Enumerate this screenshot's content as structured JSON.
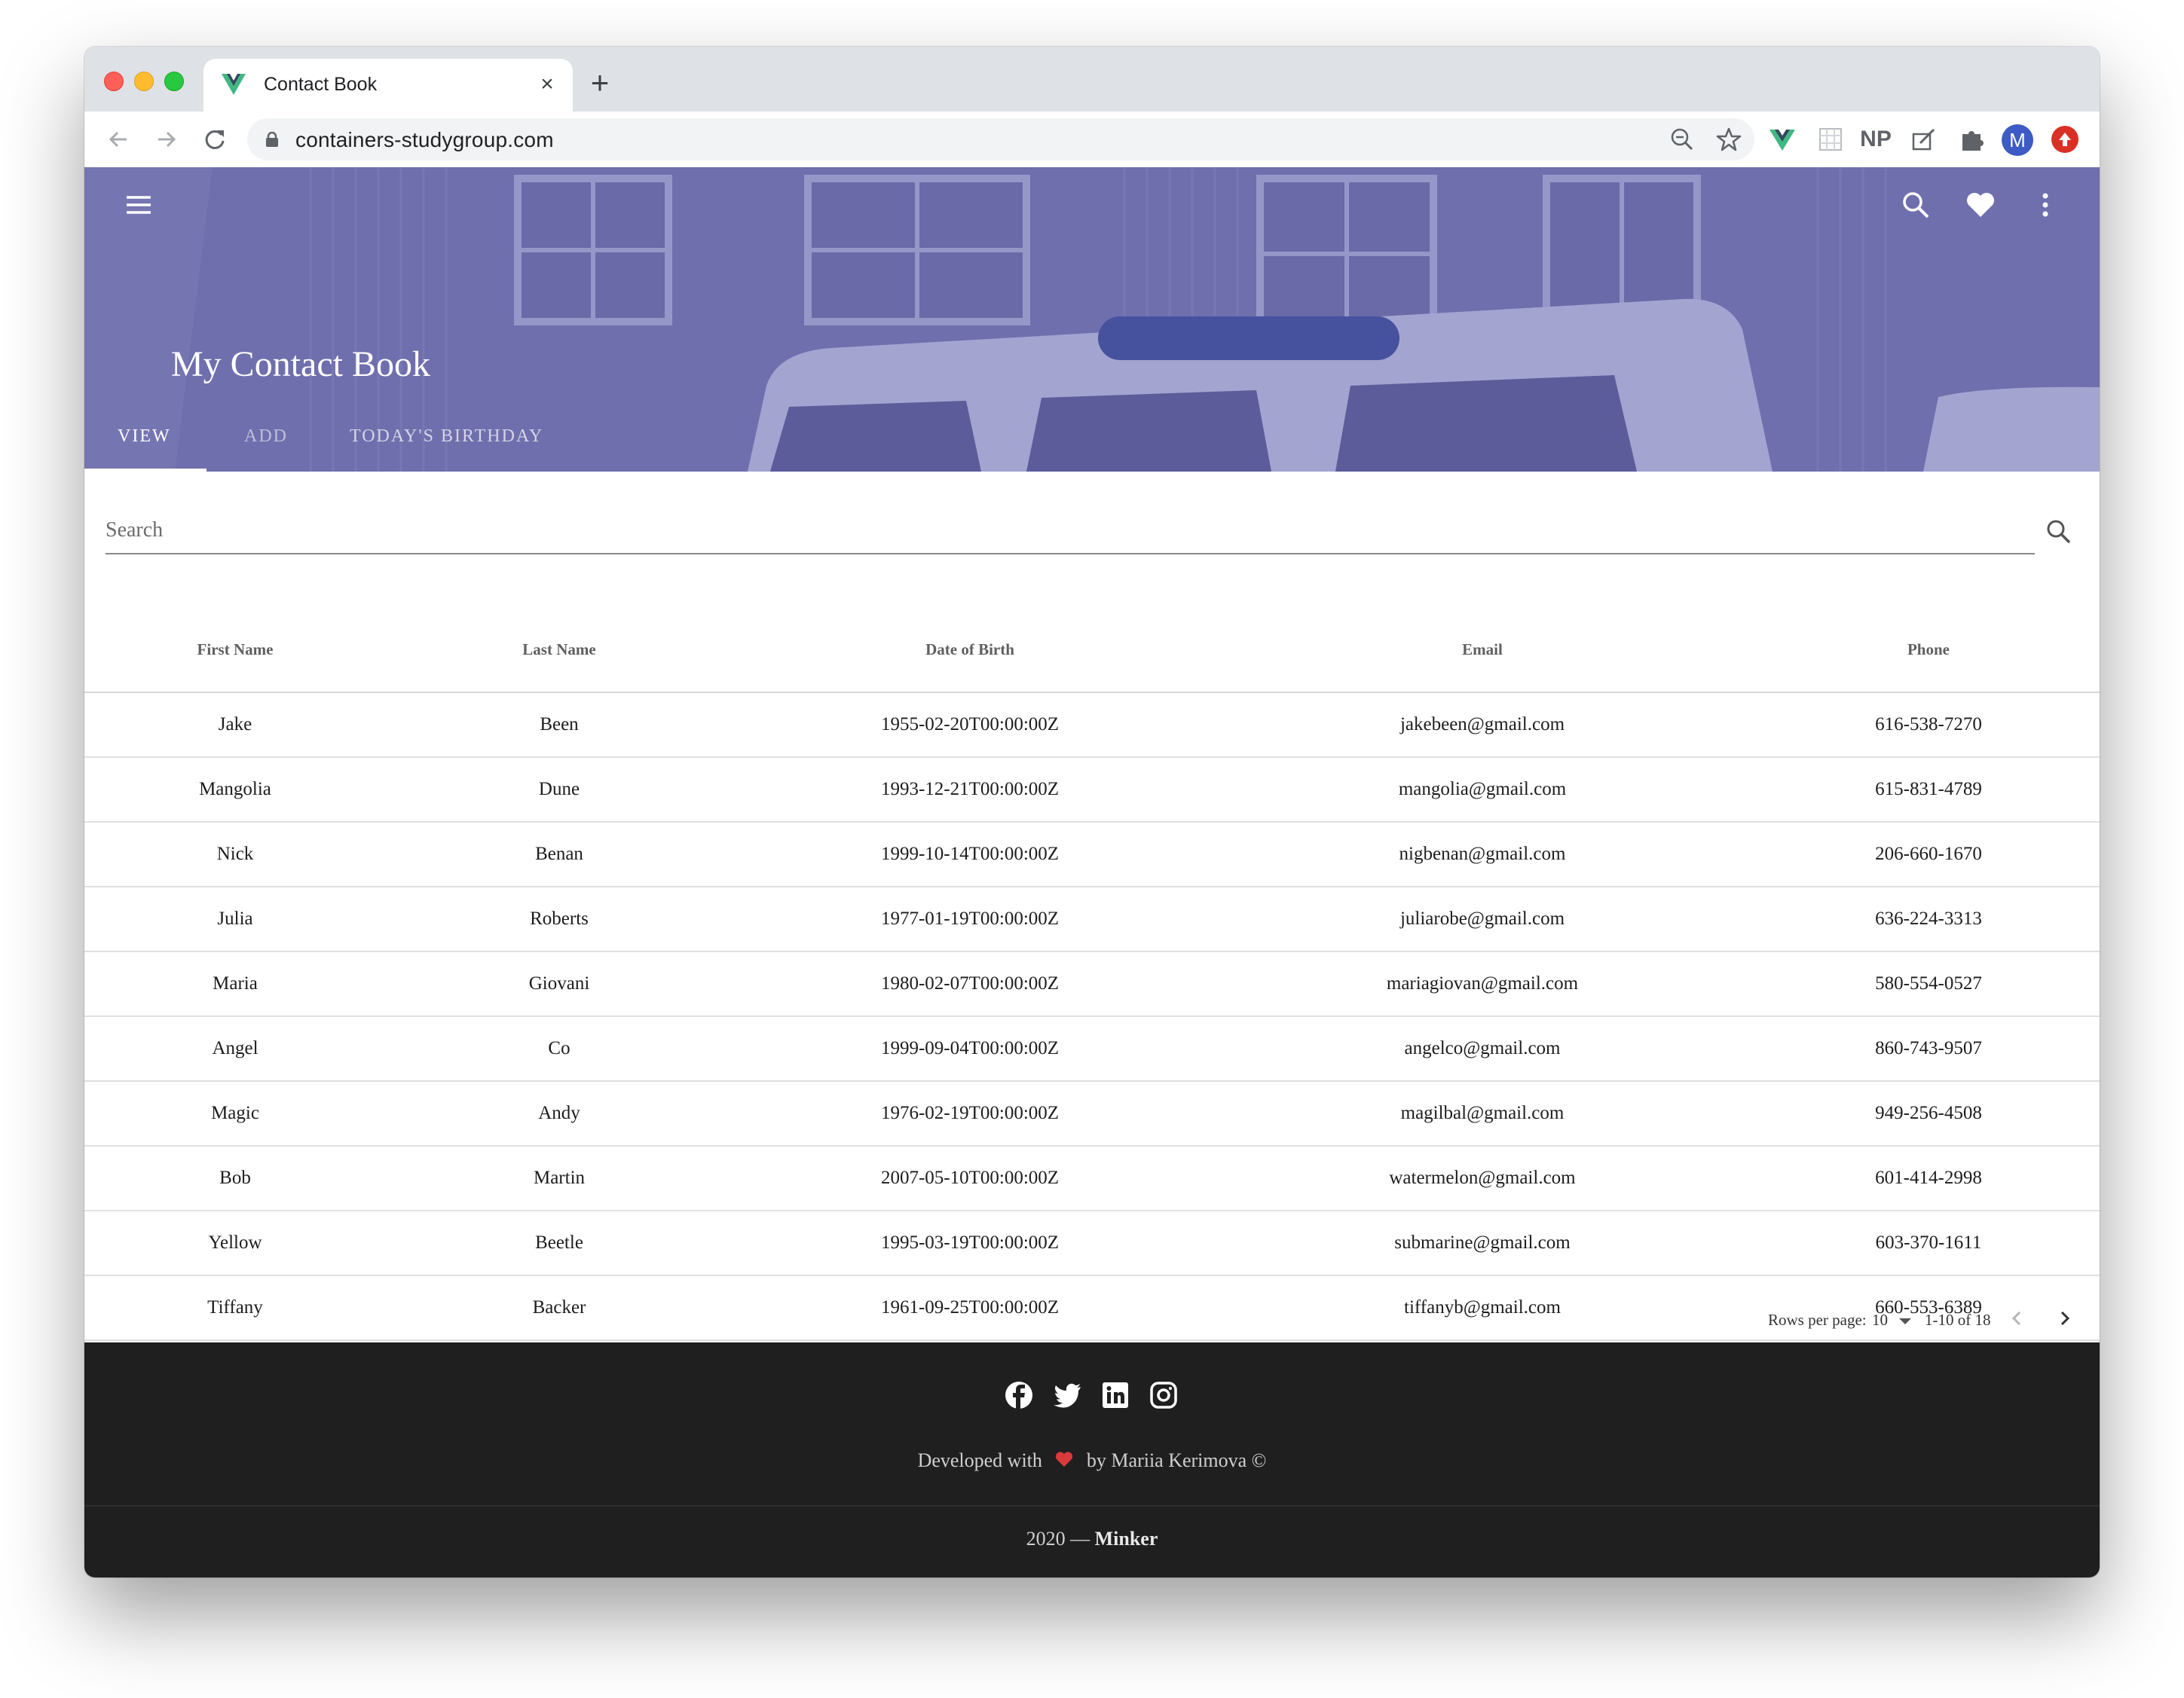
{
  "browser": {
    "tab_title": "Contact Book",
    "url": "containers-studygroup.com",
    "ext_np_label": "NP",
    "avatar_letter": "M"
  },
  "header": {
    "title": "My Contact Book",
    "tabs": [
      "VIEW",
      "ADD",
      "TODAY'S BIRTHDAY"
    ],
    "active_tab": "VIEW"
  },
  "search": {
    "placeholder": "Search"
  },
  "table": {
    "columns": [
      "First Name",
      "Last Name",
      "Date of Birth",
      "Email",
      "Phone"
    ],
    "rows": [
      [
        "Jake",
        "Been",
        "1955-02-20T00:00:00Z",
        "jakebeen@gmail.com",
        "616-538-7270"
      ],
      [
        "Mangolia",
        "Dune",
        "1993-12-21T00:00:00Z",
        "mangolia@gmail.com",
        "615-831-4789"
      ],
      [
        "Nick",
        "Benan",
        "1999-10-14T00:00:00Z",
        "nigbenan@gmail.com",
        "206-660-1670"
      ],
      [
        "Julia",
        "Roberts",
        "1977-01-19T00:00:00Z",
        "juliarobe@gmail.com",
        "636-224-3313"
      ],
      [
        "Maria",
        "Giovani",
        "1980-02-07T00:00:00Z",
        "mariagiovan@gmail.com",
        "580-554-0527"
      ],
      [
        "Angel",
        "Co",
        "1999-09-04T00:00:00Z",
        "angelco@gmail.com",
        "860-743-9507"
      ],
      [
        "Magic",
        "Andy",
        "1976-02-19T00:00:00Z",
        "magilbal@gmail.com",
        "949-256-4508"
      ],
      [
        "Bob",
        "Martin",
        "2007-05-10T00:00:00Z",
        "watermelon@gmail.com",
        "601-414-2998"
      ],
      [
        "Yellow",
        "Beetle",
        "1995-03-19T00:00:00Z",
        "submarine@gmail.com",
        "603-370-1611"
      ],
      [
        "Tiffany",
        "Backer",
        "1961-09-25T00:00:00Z",
        "tiffanyb@gmail.com",
        "660-553-6389"
      ]
    ]
  },
  "pagination": {
    "rows_per_page_label": "Rows per page:",
    "rows_per_page_value": "10",
    "range_text": "1-10 of 18"
  },
  "footer": {
    "developed_prefix": "Developed with",
    "developed_suffix": "by Mariia Kerimova ©",
    "copyright_prefix": "2020 —",
    "copyright_name": "Minker",
    "social_icons": [
      "facebook-icon",
      "twitter-icon",
      "linkedin-icon",
      "instagram-icon"
    ]
  },
  "colors": {
    "header_tint": "#7f80b8",
    "footer_bg": "#1f1f1f",
    "heart": "#d93a3a"
  }
}
